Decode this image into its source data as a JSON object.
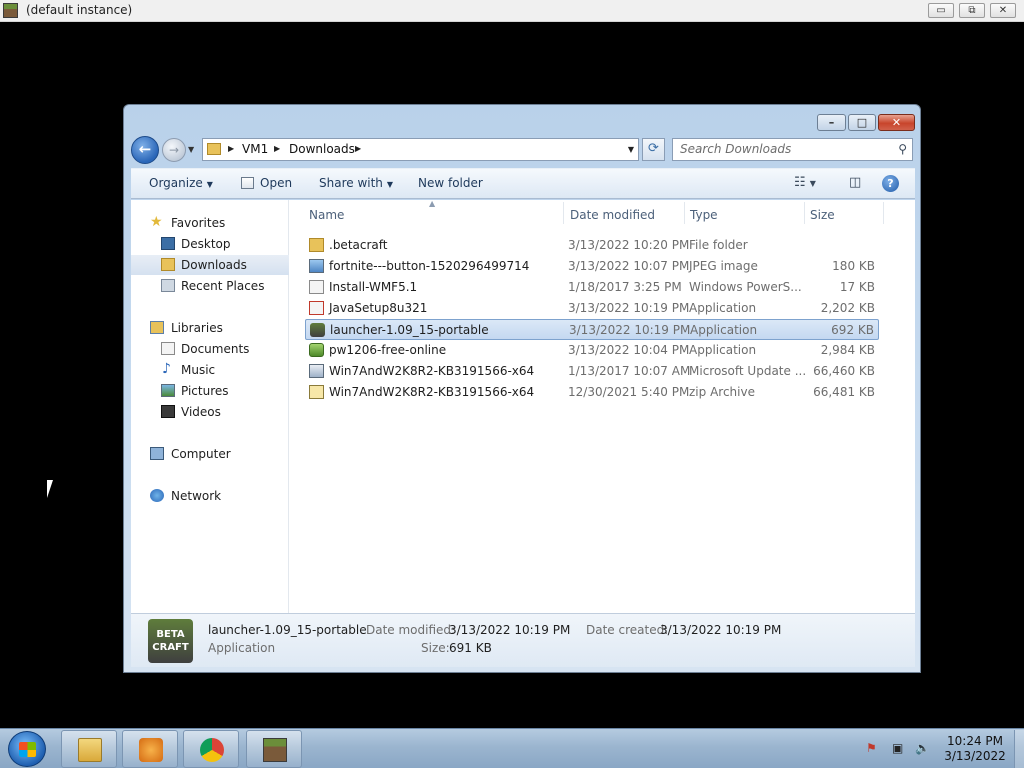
{
  "outer_window": {
    "title": "(default instance)",
    "controls": [
      "▭",
      "⧉",
      "✕"
    ]
  },
  "explorer": {
    "address": {
      "crumbs": [
        "VM1",
        "Downloads"
      ]
    },
    "search": {
      "placeholder": "Search Downloads"
    },
    "toolbar": {
      "organize": "Organize",
      "open": "Open",
      "share_with": "Share with",
      "new_folder": "New folder",
      "help": "?"
    },
    "nav": {
      "favorites": "Favorites",
      "desktop": "Desktop",
      "downloads": "Downloads",
      "recent_places": "Recent Places",
      "libraries": "Libraries",
      "documents": "Documents",
      "music": "Music",
      "pictures": "Pictures",
      "videos": "Videos",
      "computer": "Computer",
      "network": "Network"
    },
    "columns": {
      "name": "Name",
      "date": "Date modified",
      "type": "Type",
      "size": "Size"
    },
    "files": [
      {
        "name": ".betacraft",
        "date": "3/13/2022 10:20 PM",
        "type": "File folder",
        "size": "",
        "icon": "folder-icon"
      },
      {
        "name": "fortnite---button-1520296499714",
        "date": "3/13/2022 10:07 PM",
        "type": "JPEG image",
        "size": "180 KB",
        "icon": "image-icon"
      },
      {
        "name": "Install-WMF5.1",
        "date": "1/18/2017 3:25 PM",
        "type": "Windows PowerS...",
        "size": "17 KB",
        "icon": "script-icon"
      },
      {
        "name": "JavaSetup8u321",
        "date": "3/13/2022 10:19 PM",
        "type": "Application",
        "size": "2,202 KB",
        "icon": "java-icon"
      },
      {
        "name": "launcher-1.09_15-portable",
        "date": "3/13/2022 10:19 PM",
        "type": "Application",
        "size": "692 KB",
        "icon": "betacraft-icon"
      },
      {
        "name": "pw1206-free-online",
        "date": "3/13/2022 10:04 PM",
        "type": "Application",
        "size": "2,984 KB",
        "icon": "app-icon"
      },
      {
        "name": "Win7AndW2K8R2-KB3191566-x64",
        "date": "1/13/2017 10:07 AM",
        "type": "Microsoft Update ...",
        "size": "66,460 KB",
        "icon": "update-icon"
      },
      {
        "name": "Win7AndW2K8R2-KB3191566-x64",
        "date": "12/30/2021 5:40 PM",
        "type": "zip Archive",
        "size": "66,481 KB",
        "icon": "zip-icon"
      }
    ],
    "details": {
      "name": "launcher-1.09_15-portable",
      "type": "Application",
      "icon_text": "BETA CRAFT",
      "date_modified_label": "Date modified:",
      "date_modified": "3/13/2022 10:19 PM",
      "date_created_label": "Date created:",
      "date_created": "3/13/2022 10:19 PM",
      "size_label": "Size:",
      "size": "691 KB"
    }
  },
  "taskbar": {
    "clock": {
      "time": "10:24 PM",
      "date": "3/13/2022"
    }
  }
}
